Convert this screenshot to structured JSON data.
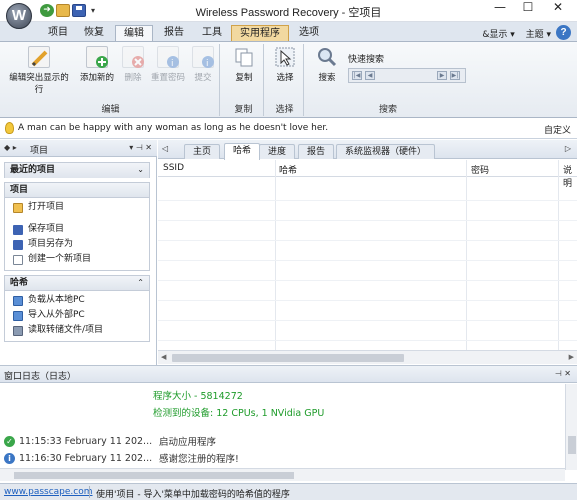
{
  "window": {
    "title": "Wireless Password Recovery - 空项目",
    "orb_letter": "W",
    "minimize": "—",
    "maximize": "☐",
    "close": "✕"
  },
  "ribbon_tabs": [
    "项目",
    "恢复",
    "编辑",
    "报告",
    "工具",
    "实用程序",
    "选项"
  ],
  "active_tab": "编辑",
  "ribbon_right": {
    "show": "&显示 ▾",
    "theme": "主题 ▾",
    "help": "?"
  },
  "ribbon": {
    "edit_group": {
      "label": "编辑",
      "buttons": [
        {
          "label": "编辑突出显示的行",
          "icon": "edit-pencil-icon",
          "enabled": true
        },
        {
          "label": "添加新的",
          "icon": "add-new-icon",
          "enabled": true
        },
        {
          "label": "删除",
          "icon": "delete-icon",
          "enabled": false
        },
        {
          "label": "重置密码",
          "icon": "reset-password-icon",
          "enabled": false
        },
        {
          "label": "提交",
          "icon": "submit-icon",
          "enabled": false
        }
      ]
    },
    "copy_group": {
      "label": "复制",
      "button": "复制"
    },
    "select_group": {
      "label": "选择",
      "button": "选择"
    },
    "search_group": {
      "label": "搜索",
      "button": "搜索",
      "quick_search_label": "快速搜索"
    }
  },
  "tip": {
    "text": "A man can be happy with any woman as long as he doesn't love her.",
    "customize": "自定义"
  },
  "left_panel": {
    "title": "项目",
    "recent_section": "最近的项目",
    "project_section": {
      "title": "项目",
      "items": [
        "打开项目"
      ]
    },
    "project_actions": [
      "保存项目",
      "项目另存为",
      "创建一个新项目"
    ],
    "hash_section": {
      "title": "哈希",
      "items": [
        "负载从本地PC",
        "导入从外部PC",
        "读取转储文件/项目"
      ]
    }
  },
  "content": {
    "tabs": [
      "主页",
      "哈希",
      "进度",
      "报告",
      "系统监视器（硬件）"
    ],
    "active_tab": "哈希",
    "columns": [
      "SSID",
      "哈希",
      "密码",
      "说明"
    ]
  },
  "log": {
    "title": "窗口日志（日志）",
    "program_size": "程序大小 - 5814272",
    "devices": "检测到的设备:   12 CPUs, 1 NVidia GPU",
    "entries": [
      {
        "time": "11:15:33 February 11 202...",
        "message": "启动应用程序",
        "icon": "success-check-icon"
      },
      {
        "time": "11:16:30 February 11 202...",
        "message": "感谢您注册的程序!",
        "icon": "info-icon"
      }
    ]
  },
  "status": {
    "link": "www.passcape.com",
    "text": "使用'项目 - 导入'菜单中加载密码的哈希值的程序"
  },
  "colors": {
    "accent": "#3b76c4",
    "ribbon_bg": "#e6ebf1",
    "log_green": "#1e9b2a",
    "utility_tab": "#f2d9a0"
  }
}
